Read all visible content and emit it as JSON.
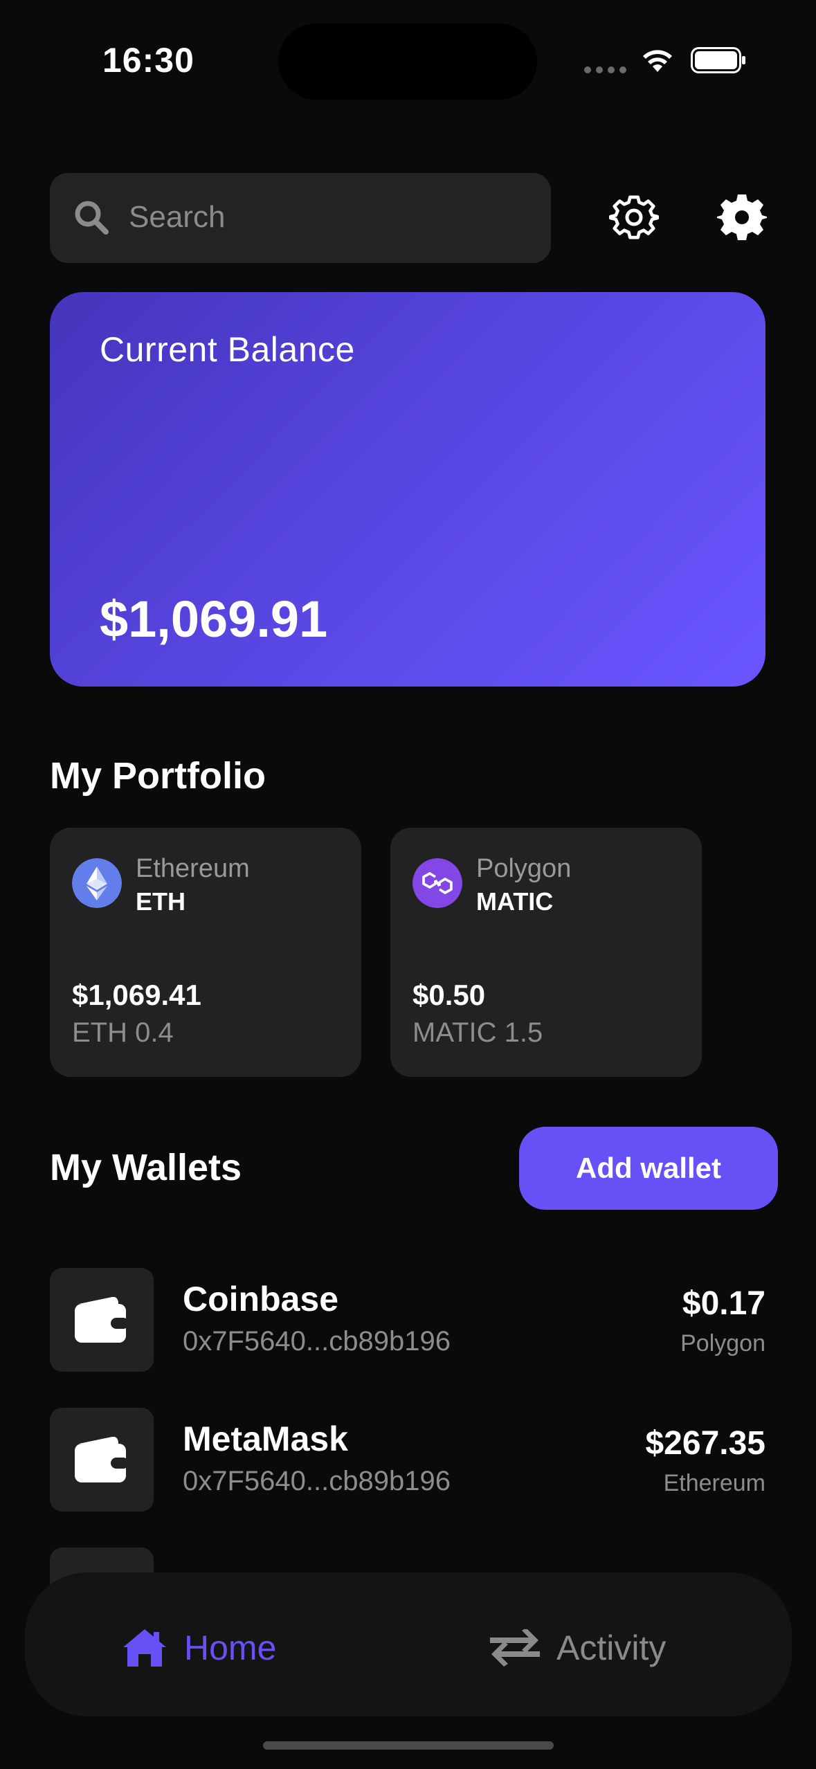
{
  "status_bar": {
    "time": "16:30"
  },
  "search": {
    "placeholder": "Search"
  },
  "balance": {
    "label": "Current Balance",
    "value": "$1,069.91"
  },
  "portfolio": {
    "title": "My Portfolio",
    "items": [
      {
        "name": "Ethereum",
        "symbol": "ETH",
        "usd_value": "$1,069.41",
        "amount": "ETH 0.4",
        "icon": "ethereum-icon",
        "color": "#627eea"
      },
      {
        "name": "Polygon",
        "symbol": "MATIC",
        "usd_value": "$0.50",
        "amount": "MATIC 1.5",
        "icon": "polygon-icon",
        "color": "#8247e5"
      }
    ]
  },
  "wallets": {
    "title": "My Wallets",
    "add_label": "Add wallet",
    "items": [
      {
        "name": "Coinbase",
        "address": "0x7F5640...cb89b196",
        "amount": "$0.17",
        "network": "Polygon",
        "icon": "wallet-icon"
      },
      {
        "name": "MetaMask",
        "address": "0x7F5640...cb89b196",
        "amount": "$267.35",
        "network": "Ethereum",
        "icon": "wallet-icon"
      }
    ]
  },
  "nav": {
    "items": [
      {
        "label": "Home",
        "icon": "home-icon",
        "active": true
      },
      {
        "label": "Activity",
        "icon": "swap-arrows-icon",
        "active": false
      }
    ]
  },
  "colors": {
    "accent": "#6551f5",
    "background": "#0a0a0a",
    "card": "#222222"
  }
}
